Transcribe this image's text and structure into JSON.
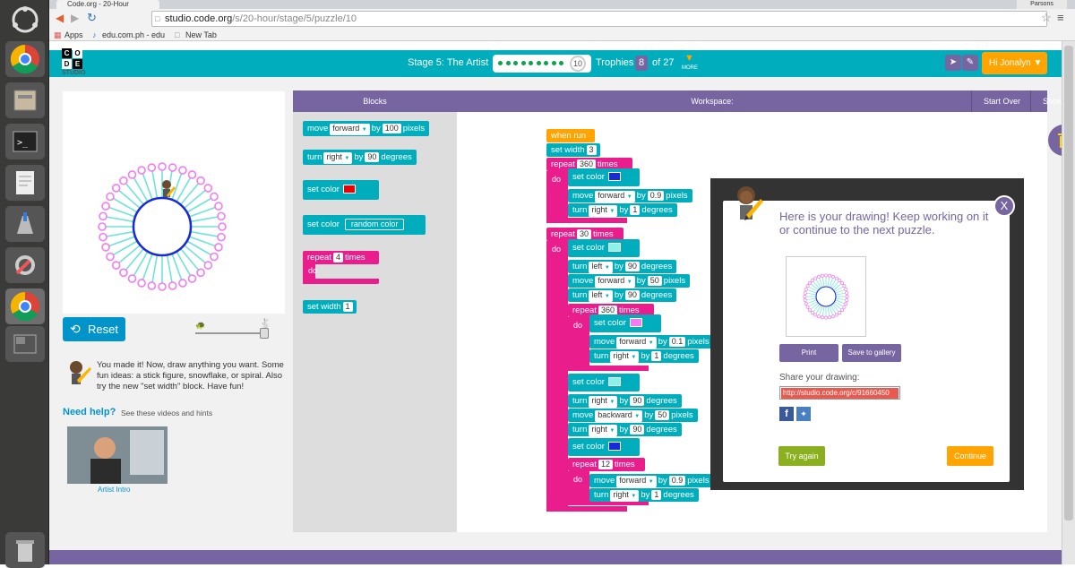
{
  "browser": {
    "tab_title": "Code.org - 20-Hour",
    "url_domain": "studio.code.org",
    "url_path": "/s/20-hour/stage/5/puzzle/10",
    "bookmark_apps": "Apps",
    "bookmark_edu": "edu.com.ph - edu",
    "bookmark_newtab": "New Tab",
    "profile": "Parsons"
  },
  "header": {
    "logo_letters": [
      "C",
      "O",
      "D",
      "E"
    ],
    "logo_sub": "STUDIO",
    "stage_label": "Stage 5: The Artist",
    "current_puzzle": "10",
    "completed_dots": 9,
    "trophies_label": "Trophies",
    "trophies_count": "8",
    "trophies_total": "of 27",
    "more_label": "MORE",
    "user_button": "Hi Jonalyn ▼"
  },
  "left": {
    "reset_label": "Reset",
    "instructions": "You made it! Now, draw anything you want. Some fun ideas: a stick figure, snowflake, or spiral. Also try the new \"set width\" block. Have fun!",
    "need_help": "Need help?",
    "need_help_sub": "See these videos and hints",
    "video_caption": "Artist Intro",
    "speed_fraction": 1.0
  },
  "panels": {
    "blocks_header": "Blocks",
    "workspace_header": "Workspace:",
    "start_over": "Start Over",
    "show_code": "Show Code"
  },
  "toolbox": {
    "move_word": "move",
    "forward": "forward",
    "by": "by",
    "move_val": "100",
    "pixels": "pixels",
    "turn_word": "turn",
    "right": "right",
    "turn_val": "90",
    "degrees": "degrees",
    "set_color": "set color",
    "random_color": "random color",
    "repeat": "repeat",
    "repeat_val": "4",
    "times": "times",
    "do": "do",
    "set_width": "set width",
    "width_val": "1"
  },
  "workspace": {
    "when_run": "when run",
    "set_width": "set width",
    "width_val": "3",
    "repeat": "repeat",
    "times": "times",
    "do": "do",
    "set_color": "set color",
    "move": "move",
    "turn": "turn",
    "by": "by",
    "pixels": "pixels",
    "degrees": "degrees",
    "forward": "forward",
    "backward": "backward",
    "right": "right",
    "left": "left",
    "r1": "360",
    "v_forward1": "0.9",
    "v_turn1": "1",
    "r2": "30",
    "v_left1": "90",
    "v_fwd50": "50",
    "v_left2": "90",
    "r3": "360",
    "v_fwd01": "0.1",
    "v_turn3": "1",
    "v_right90a": "90",
    "v_back50": "50",
    "v_right90b": "90",
    "r4": "12",
    "v_fwd09b": "0.9",
    "v_turn4": "1"
  },
  "dialog": {
    "message": "Here is your drawing! Keep working on it or continue to the next puzzle.",
    "print": "Print",
    "save": "Save to gallery",
    "share_label": "Share your drawing:",
    "share_url": "http://studio.code.org/c/91660450",
    "try_again": "Try again",
    "continue": "Continue",
    "close": "X"
  },
  "colors": {
    "teal": "#00adbc",
    "purple": "#7665a0",
    "pink": "#e91e8c",
    "orange": "#ffa400",
    "green": "#8bb01f"
  }
}
